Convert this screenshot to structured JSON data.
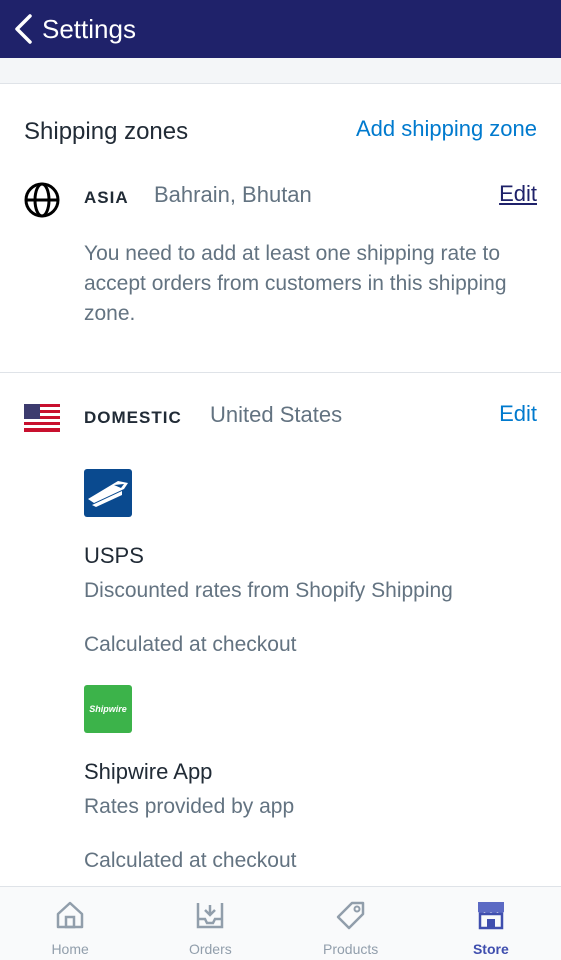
{
  "header": {
    "back_label": "Settings"
  },
  "section": {
    "title": "Shipping zones",
    "add_link": "Add shipping zone"
  },
  "zones": [
    {
      "code": "ASIA",
      "countries": "Bahrain, Bhutan",
      "edit": "Edit",
      "icon": "globe-icon",
      "warning": "You need to add at least one shipping rate to accept orders from customers in this shipping zone."
    },
    {
      "code": "DOMESTIC",
      "countries": "United States",
      "edit": "Edit",
      "icon": "us-flag-icon",
      "carriers": [
        {
          "name": "USPS",
          "description": "Discounted rates from Shopify Shipping",
          "calc": "Calculated at checkout",
          "icon": "usps-logo-icon"
        },
        {
          "name": "Shipwire App",
          "logo_text": "Shipwire",
          "description": "Rates provided by app",
          "calc": "Calculated at checkout",
          "icon": "shipwire-logo-icon"
        }
      ]
    }
  ],
  "tabs": [
    {
      "label": "Home",
      "icon": "home-icon",
      "active": false
    },
    {
      "label": "Orders",
      "icon": "orders-inbox-icon",
      "active": false
    },
    {
      "label": "Products",
      "icon": "tag-icon",
      "active": false
    },
    {
      "label": "Store",
      "icon": "store-icon",
      "active": true
    }
  ],
  "colors": {
    "header_bg": "#1f226a",
    "link": "#007ace",
    "edit_underlined": "#1f226a",
    "active_tab": "#3f4eae",
    "usps_blue": "#0a4a8f",
    "shipwire_green": "#3cb34a"
  }
}
